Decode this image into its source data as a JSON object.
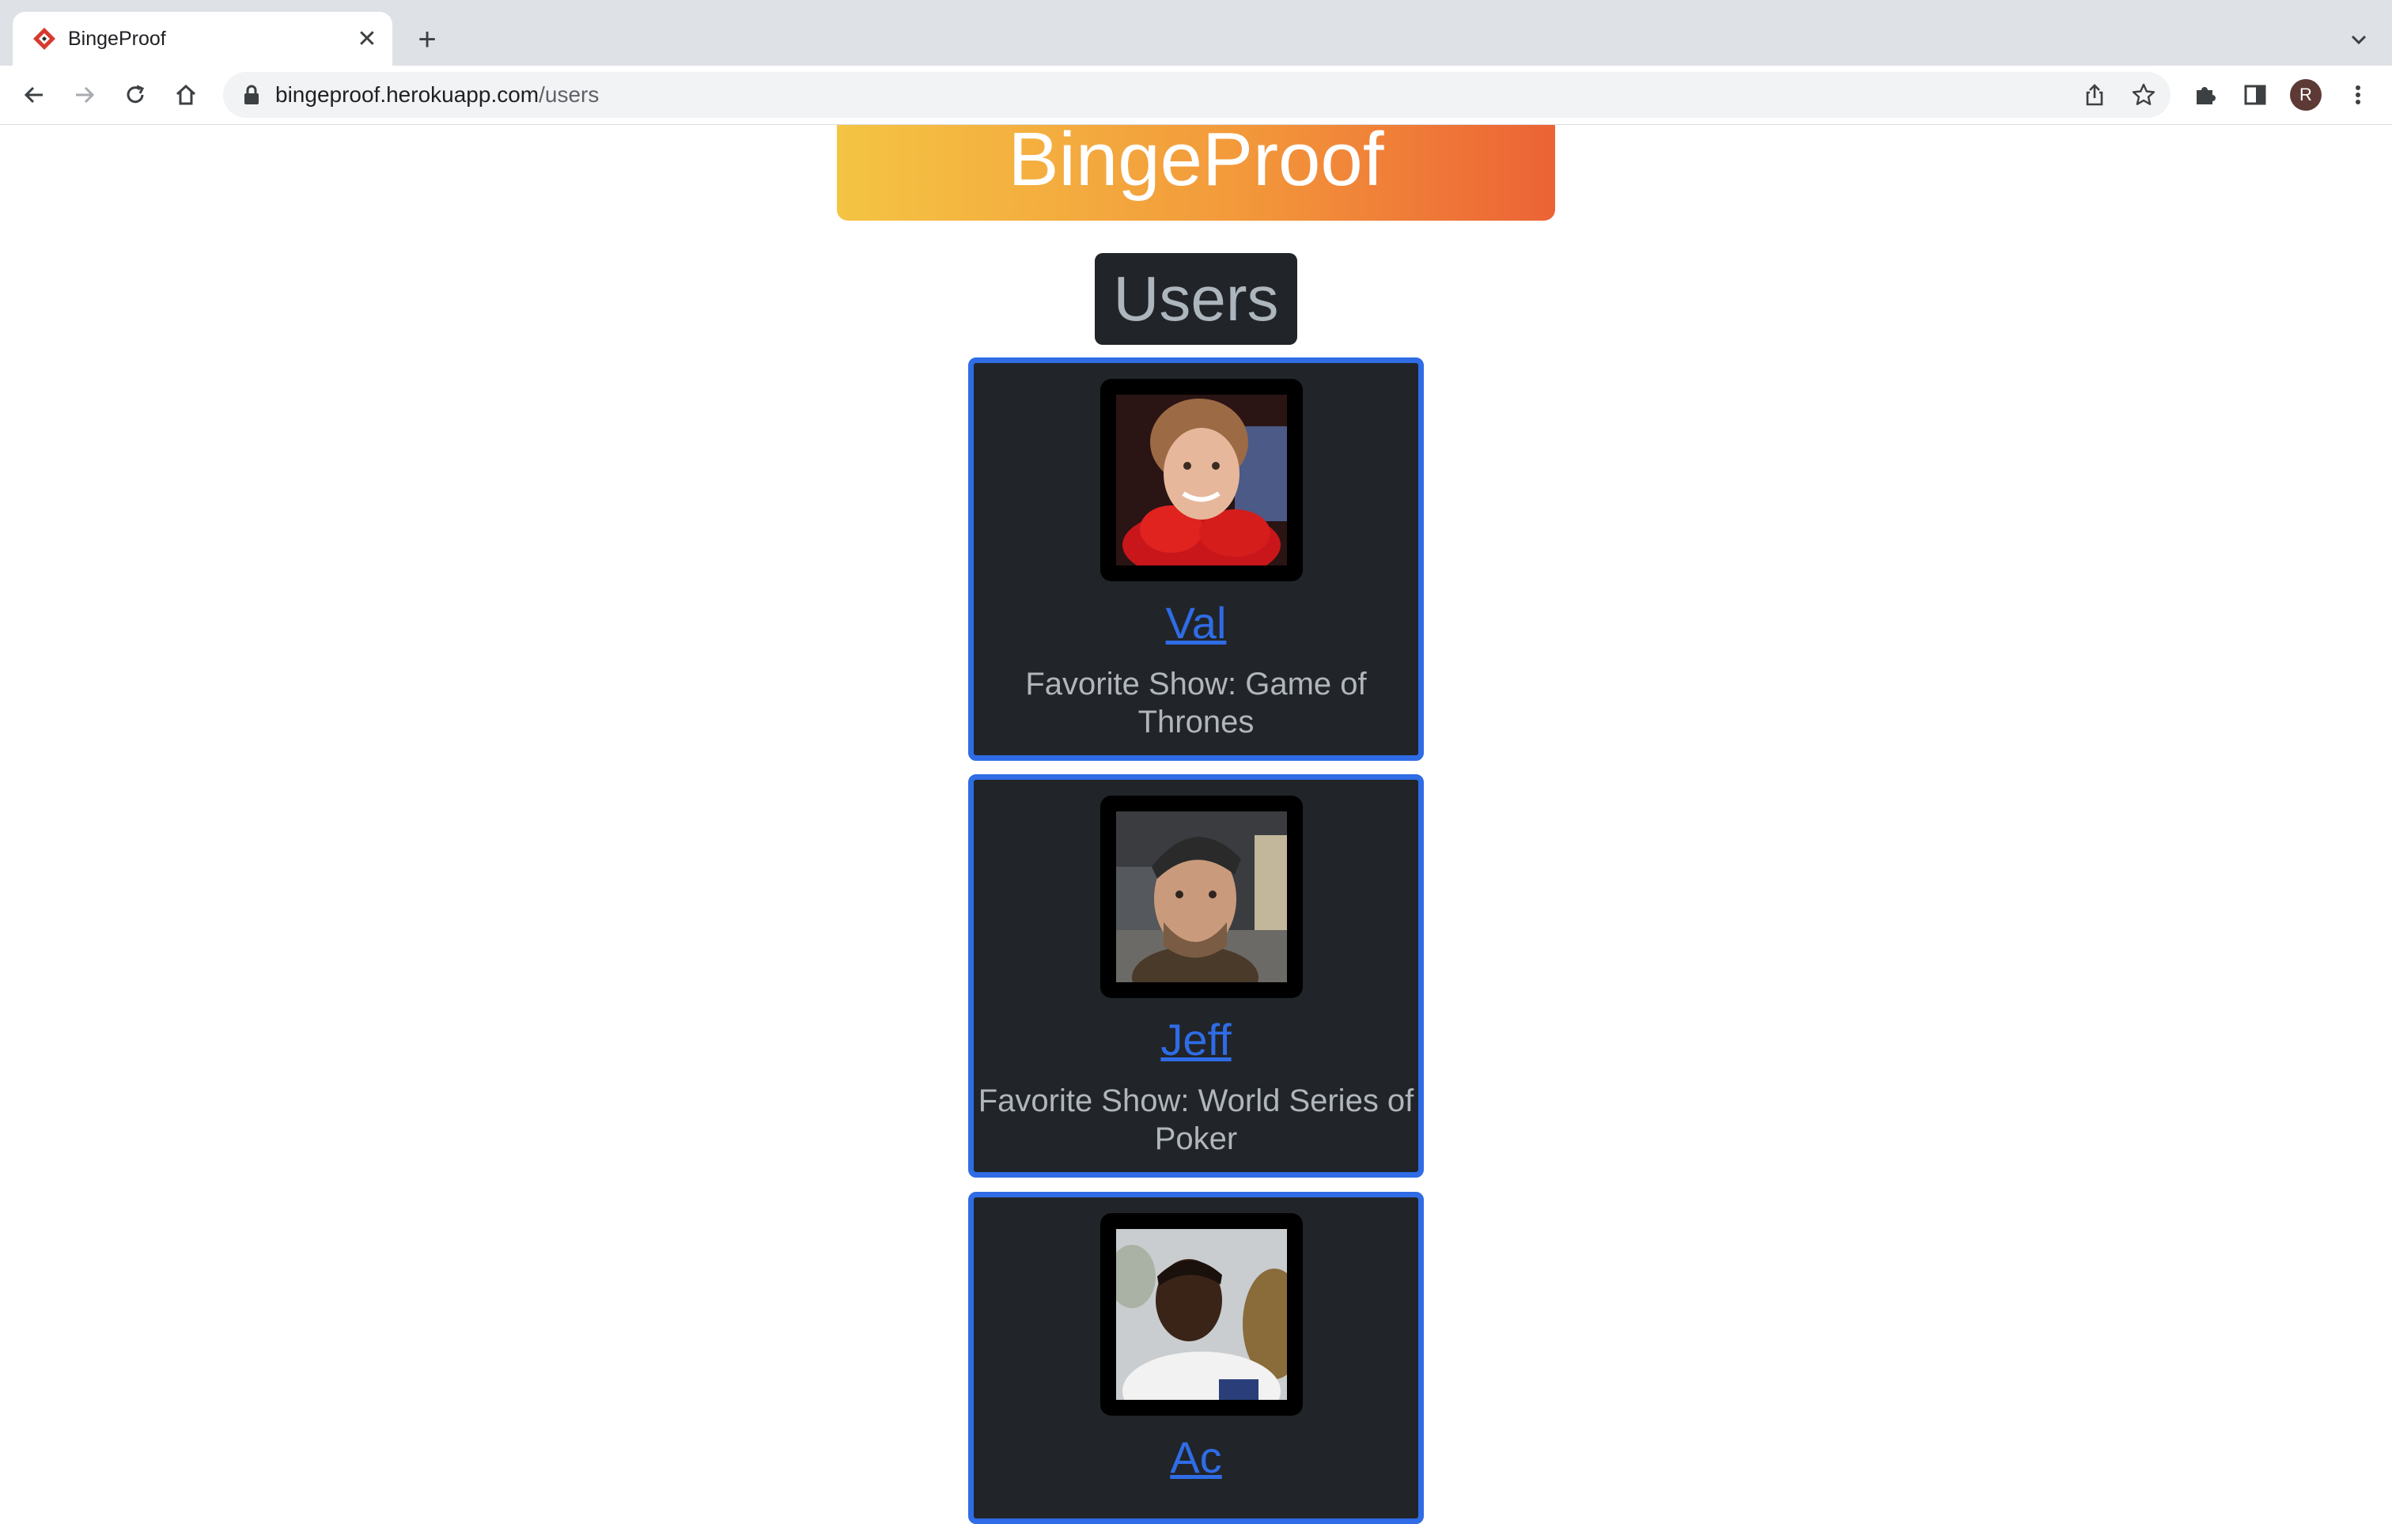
{
  "browser": {
    "tab_title": "BingeProof",
    "url_host": "bingeproof.herokuapp.com",
    "url_path": "/users",
    "profile_initial": "R"
  },
  "page": {
    "site_title": "BingeProof",
    "section_title": "Users",
    "users": [
      {
        "name": "Val",
        "favorite": "Favorite Show: Game of Thrones"
      },
      {
        "name": "Jeff",
        "favorite": "Favorite Show: World Series of Poker"
      },
      {
        "name": "Ac",
        "favorite": ""
      }
    ]
  },
  "colors": {
    "card_border": "#2f6ce6",
    "card_bg": "#212529",
    "banner_start": "#f4c443",
    "banner_end": "#ec6335"
  }
}
